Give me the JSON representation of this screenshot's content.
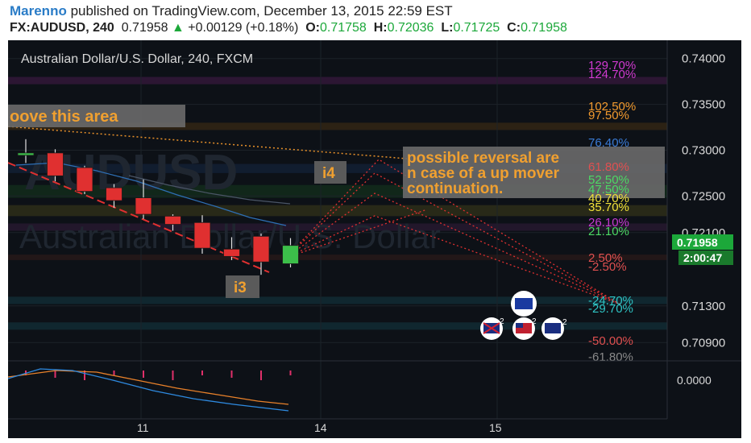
{
  "header": {
    "author": "Marenno",
    "published_text": " published on TradingView.com, December 13, 2015 22:59 EST",
    "symbol": "FX:AUDUSD, 240",
    "last": "0.71958",
    "up_arrow": "▲",
    "change": "+0.00129 (+0.18%)",
    "o_label": "O:",
    "o_value": "0.71758",
    "h_label": "H:",
    "h_value": "0.72036",
    "l_label": "L:",
    "l_value": "0.71725",
    "c_label": "C:",
    "c_value": "0.71958"
  },
  "chart": {
    "title": "Australian Dollar/U.S. Dollar, 240, FXCM",
    "watermark_line1": "AUDUSD",
    "watermark_line2": "Australian Dollar/U.S. Dollar",
    "price_labels": [
      "0.74000",
      "0.73500",
      "0.73000",
      "0.72500",
      "0.72100",
      "0.71300",
      "0.70900"
    ],
    "current_price": "0.71958",
    "countdown": "2:00:47",
    "x_labels": [
      "11",
      "14",
      "15"
    ],
    "osc_label": "0.0000",
    "annotations": {
      "above_area": "oove this area",
      "reversal_line1": "possible reversal are",
      "reversal_line2": "n case of a up mover",
      "reversal_line3": "continuation.",
      "i3": "i3",
      "i4": "i4"
    },
    "fib_labels": [
      {
        "text": "129.70%",
        "color": "#d23ad2"
      },
      {
        "text": "124.70%",
        "color": "#d23ad2"
      },
      {
        "text": "102.50%",
        "color": "#f29a2e"
      },
      {
        "text": "97.50%",
        "color": "#f29a2e"
      },
      {
        "text": "76.40%",
        "color": "#3a7bd5"
      },
      {
        "text": "61.80%",
        "color": "#e05050"
      },
      {
        "text": "52.50%",
        "color": "#4cd964"
      },
      {
        "text": "47.50%",
        "color": "#4cd964"
      },
      {
        "text": "40.70%",
        "color": "#f2e23a"
      },
      {
        "text": "35.70%",
        "color": "#f2e23a"
      },
      {
        "text": "26.10%",
        "color": "#c63ad2"
      },
      {
        "text": "21.10%",
        "color": "#4cd964"
      },
      {
        "text": "2.50%",
        "color": "#e05050"
      },
      {
        "text": "-2.50%",
        "color": "#e05050"
      },
      {
        "text": "-24.70%",
        "color": "#2ec4c4"
      },
      {
        "text": "-29.70%",
        "color": "#2ec4c4"
      },
      {
        "text": "-50.00%",
        "color": "#e05050"
      },
      {
        "text": "-61.80%",
        "color": "#8a8a8a"
      }
    ],
    "event_badges": [
      "2",
      "2",
      "2"
    ]
  },
  "chart_data": {
    "type": "candlestick",
    "timeframe": "240",
    "ylim": [
      0.707,
      0.742
    ],
    "candles": [
      {
        "o": 0.7297,
        "h": 0.7312,
        "l": 0.7286,
        "c": 0.7297,
        "dir": "up"
      },
      {
        "o": 0.7297,
        "h": 0.7301,
        "l": 0.7266,
        "c": 0.7272,
        "dir": "down"
      },
      {
        "o": 0.7281,
        "h": 0.7283,
        "l": 0.7252,
        "c": 0.7255,
        "dir": "down"
      },
      {
        "o": 0.7259,
        "h": 0.7263,
        "l": 0.7237,
        "c": 0.7245,
        "dir": "down"
      },
      {
        "o": 0.7248,
        "h": 0.7268,
        "l": 0.7225,
        "c": 0.723,
        "dir": "down"
      },
      {
        "o": 0.7228,
        "h": 0.723,
        "l": 0.7212,
        "c": 0.7219,
        "dir": "down"
      },
      {
        "o": 0.7221,
        "h": 0.7229,
        "l": 0.7187,
        "c": 0.7193,
        "dir": "down"
      },
      {
        "o": 0.7192,
        "h": 0.7205,
        "l": 0.718,
        "c": 0.7184,
        "dir": "down"
      },
      {
        "o": 0.7206,
        "h": 0.7209,
        "l": 0.7164,
        "c": 0.7178,
        "dir": "down"
      },
      {
        "o": 0.7176,
        "h": 0.7204,
        "l": 0.7172,
        "c": 0.7196,
        "dir": "up"
      }
    ],
    "y_ticks": [
      0.74,
      0.735,
      0.73,
      0.725,
      0.721,
      0.713,
      0.709
    ],
    "current_price": 0.71958,
    "oscillator": {
      "zero_label": "0.0000"
    }
  }
}
